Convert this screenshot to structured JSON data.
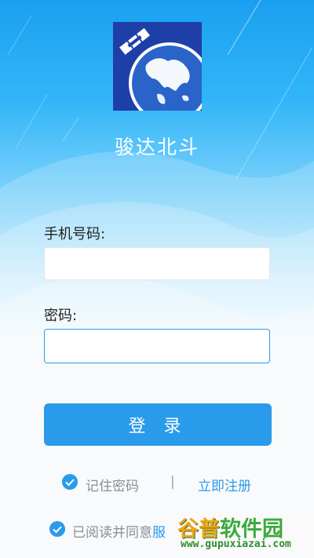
{
  "app": {
    "name": "骏达北斗"
  },
  "form": {
    "phone_label": "手机号码:",
    "phone_value": "",
    "password_label": "密码:",
    "password_value": "",
    "login_button": "登 录"
  },
  "options": {
    "remember_password": "记住密码",
    "remember_checked": true,
    "divider": "|",
    "register": "立即注册",
    "agreement_prefix": "已阅读并同意",
    "agreement_link_fragment": "服",
    "agreement_checked": true
  },
  "watermark": {
    "brand_part1": "谷普",
    "brand_part2": "软件园",
    "url": "www.gupuxiazai.com"
  },
  "colors": {
    "primary": "#2a9bea",
    "header_top": "#1aa0f0",
    "logo_bg": "#1e3fa8",
    "background": "#f5f7f9"
  }
}
